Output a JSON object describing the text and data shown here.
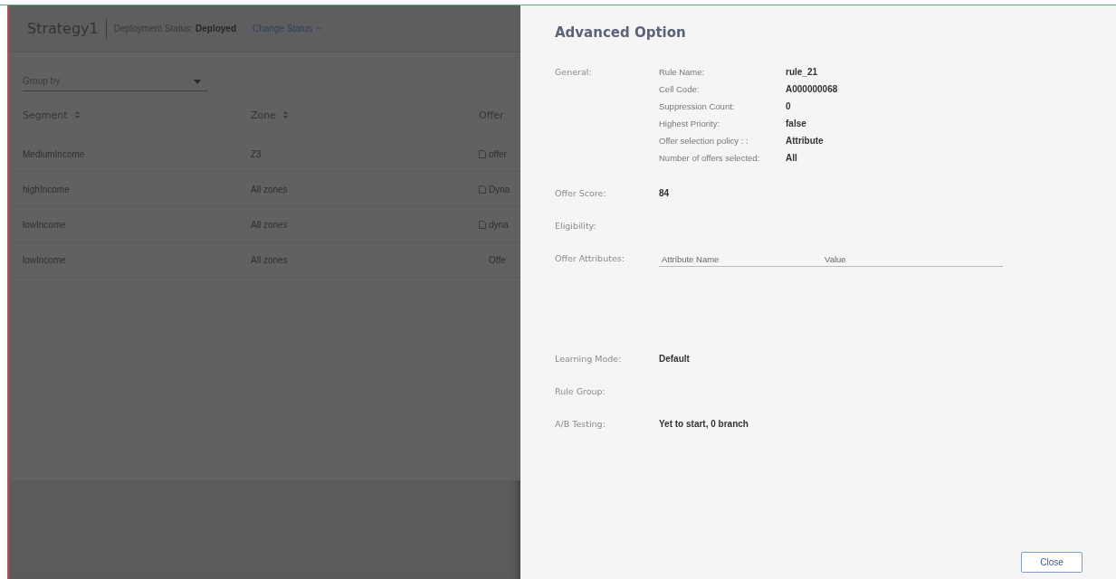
{
  "strategy": {
    "title": "Strategy1",
    "status_label": "Deployment Status:",
    "status_value": "Deployed",
    "change_status": "Change Status"
  },
  "group_by": {
    "placeholder": "Group by"
  },
  "table": {
    "columns": [
      {
        "label": "Segment",
        "sortable": true
      },
      {
        "label": "Zone",
        "sortable": true
      },
      {
        "label": "Offer",
        "sortable": false
      }
    ],
    "rows": [
      {
        "cells": [
          "MediumIncome",
          "Z3",
          "offer"
        ],
        "offer_icon": true
      },
      {
        "cells": [
          "highIncome",
          "All zones",
          "Dyna"
        ],
        "offer_icon": true
      },
      {
        "cells": [
          "lowIncome",
          "All zones",
          "dyna"
        ],
        "offer_icon": true
      },
      {
        "cells": [
          "lowIncome",
          "All zones",
          "Offe"
        ],
        "offer_icon": false
      }
    ]
  },
  "drawer": {
    "title": "Advanced Option",
    "general_label": "General:",
    "general": [
      {
        "label": "Rule Name:",
        "value": "rule_21"
      },
      {
        "label": "Cell Code:",
        "value": "A000000068"
      },
      {
        "label": "Suppression Count:",
        "value": "0"
      },
      {
        "label": "Highest Priority:",
        "value": "false"
      },
      {
        "label": "Offer selection policy : :",
        "value": "Attribute"
      },
      {
        "label": "Number of offers selected:",
        "value": "All"
      }
    ],
    "sections": [
      {
        "kind": "pair",
        "label": "Offer Score:",
        "value": "84"
      },
      {
        "kind": "pair",
        "label": "Eligibility:"
      },
      {
        "kind": "table",
        "label": "Offer Attributes:",
        "columns": [
          "Attribute Name",
          "Value"
        ]
      },
      {
        "kind": "pair",
        "label": "Learning Mode:",
        "value": "Default"
      },
      {
        "kind": "pair",
        "label": "Rule Group:"
      },
      {
        "kind": "pair",
        "label": "A/B Testing:",
        "value": "Yet to start, 0 branch"
      }
    ],
    "close": "Close"
  }
}
